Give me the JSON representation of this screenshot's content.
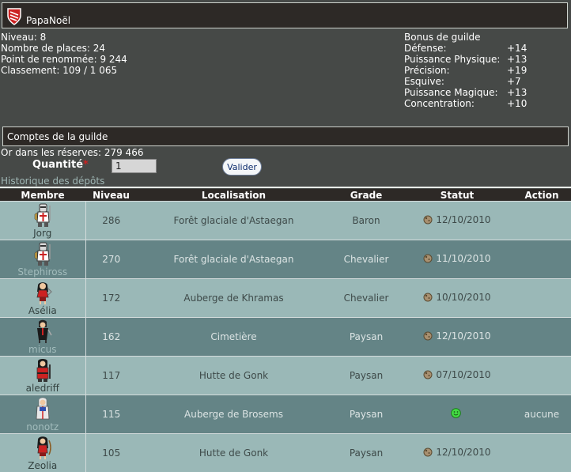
{
  "guild": {
    "name": "PapaNoël",
    "shield_icon": "guild-shield-icon",
    "colors": {
      "shield_red": "#cc2222",
      "header_bg": "#2d2926"
    }
  },
  "stats": [
    {
      "label": "Niveau:",
      "value": "8"
    },
    {
      "label": "Nombre de places:",
      "value": "24"
    },
    {
      "label": "Point de renommée:",
      "value": "9 244"
    },
    {
      "label": "Classement:",
      "value": "109 / 1 065"
    }
  ],
  "bonus": {
    "title": "Bonus de guilde",
    "items": [
      {
        "label": "Défense:",
        "value": "+14"
      },
      {
        "label": "Puissance Physique:",
        "value": "+13"
      },
      {
        "label": "Précision:",
        "value": "+19"
      },
      {
        "label": "Esquive:",
        "value": "+7"
      },
      {
        "label": "Puissance Magique:",
        "value": "+13"
      },
      {
        "label": "Concentration:",
        "value": "+10"
      }
    ]
  },
  "accounts": {
    "title": "Comptes de la guilde",
    "reserves": "Or dans les réserves: 279 466",
    "quantity_label": "Quantité",
    "required_star": "*",
    "quantity_value": "1",
    "validate_label": "Valider",
    "history_link": "Historique des dépôts"
  },
  "table": {
    "headers": [
      "Membre",
      "Niveau",
      "Localisation",
      "Grade",
      "Statut",
      "Action"
    ],
    "rows": [
      {
        "member": "Jorg",
        "avatar": "knight-avatar-icon",
        "level": "286",
        "location": "Forêt glaciale d'Astaegan",
        "grade": "Baron",
        "status_icon": "moon-status-icon",
        "status": "12/10/2010",
        "action": ""
      },
      {
        "member": "Stephiross",
        "avatar": "knight-avatar-icon",
        "level": "270",
        "location": "Forêt glaciale d'Astaegan",
        "grade": "Chevalier",
        "status_icon": "moon-status-icon",
        "status": "11/10/2010",
        "action": ""
      },
      {
        "member": "Asélia",
        "avatar": "amazon-avatar-icon",
        "level": "172",
        "location": "Auberge de Khramas",
        "grade": "Chevalier",
        "status_icon": "moon-status-icon",
        "status": "10/10/2010",
        "action": ""
      },
      {
        "member": "micus",
        "avatar": "rogue-avatar-icon",
        "level": "162",
        "location": "Cimetière",
        "grade": "Paysan",
        "status_icon": "moon-status-icon",
        "status": "12/10/2010",
        "action": ""
      },
      {
        "member": "aledriff",
        "avatar": "warrior-avatar-icon",
        "level": "117",
        "location": "Hutte de Gonk",
        "grade": "Paysan",
        "status_icon": "moon-status-icon",
        "status": "07/10/2010",
        "action": ""
      },
      {
        "member": "nonotz",
        "avatar": "mage-avatar-icon",
        "level": "115",
        "location": "Auberge de Brosems",
        "grade": "Paysan",
        "status_icon": "online-smiley-icon",
        "status": "",
        "action": "aucune"
      },
      {
        "member": "Zeolia",
        "avatar": "archer-avatar-icon",
        "level": "105",
        "location": "Hutte de Gonk",
        "grade": "Paysan",
        "status_icon": "moon-status-icon",
        "status": "12/10/2010",
        "action": ""
      }
    ]
  }
}
